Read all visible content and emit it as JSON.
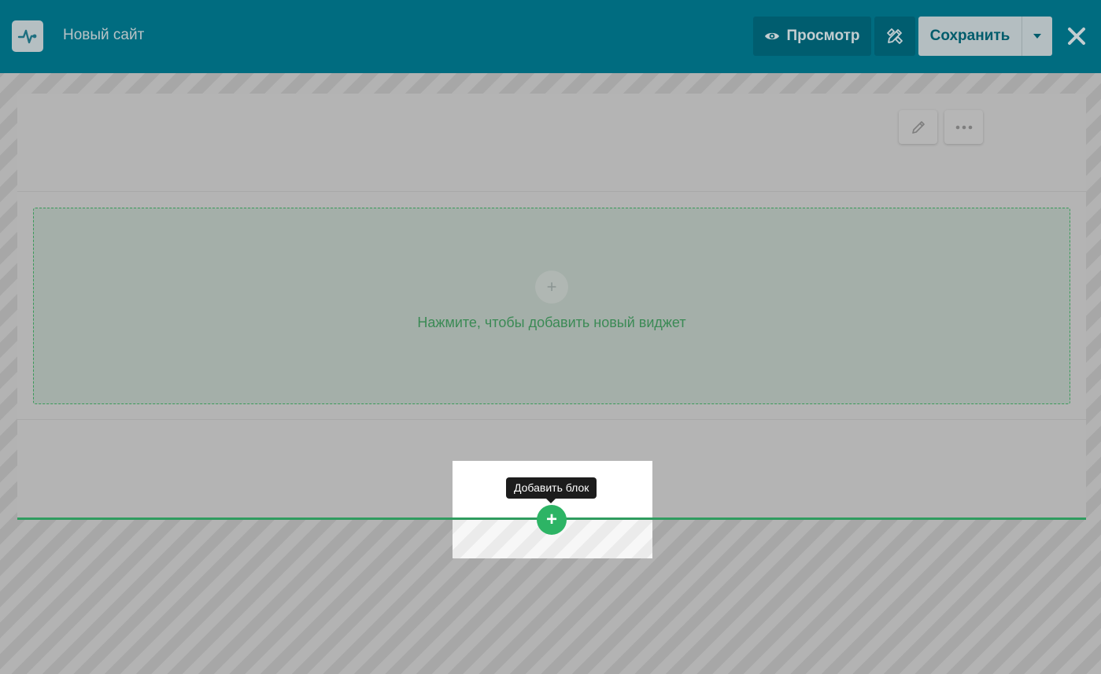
{
  "header": {
    "site_title": "Новый сайт",
    "logo_icon": "pulse-icon",
    "preview_label": "Просмотр",
    "preview_icon": "eye-icon",
    "design_icon": "design-tools-icon",
    "save_label": "Сохранить",
    "save_dropdown_icon": "caret-down-icon",
    "close_icon": "close-icon"
  },
  "section": {
    "edit_icon": "pencil-icon",
    "more_icon": "more-dots-icon",
    "add_widget_symbol": "+",
    "add_widget_text": "Нажмите, чтобы добавить новый виджет"
  },
  "add_block": {
    "symbol": "+",
    "tooltip": "Добавить блок"
  },
  "colors": {
    "topbar": "#006c80",
    "accent_green": "#2db465",
    "widget_text": "#3b8a55"
  }
}
